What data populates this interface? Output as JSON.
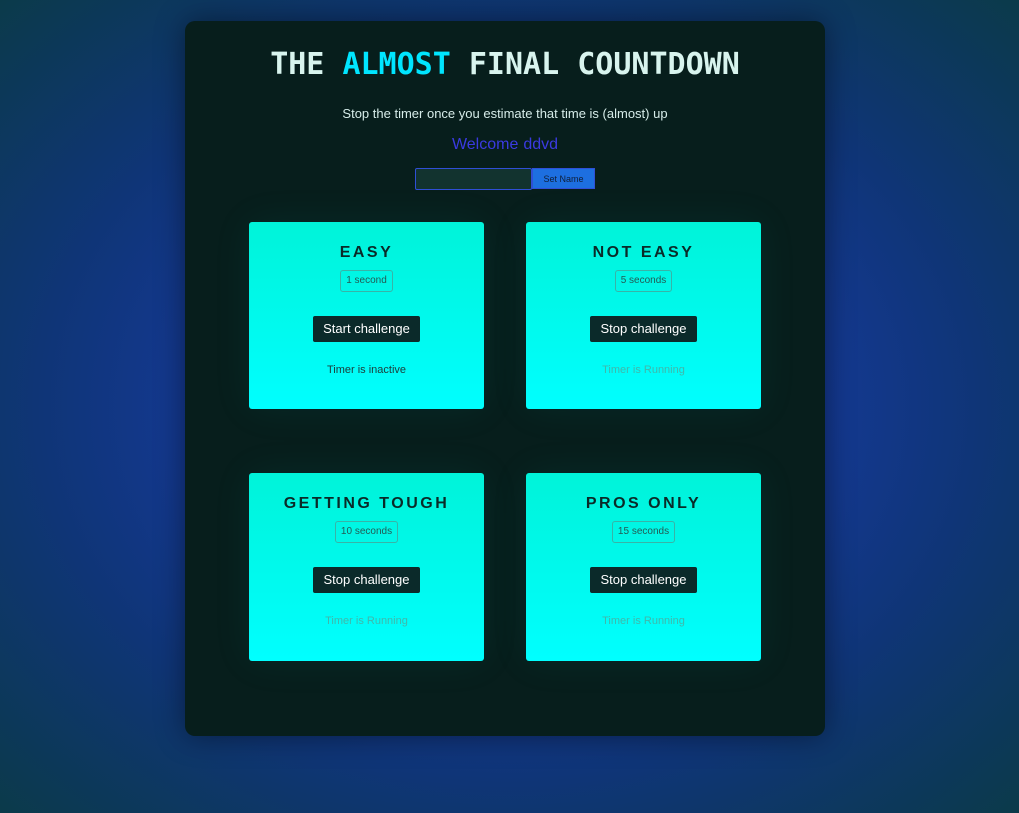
{
  "header": {
    "title_part1": "THE ",
    "title_highlight": "ALMOST",
    "title_part2": " FINAL COUNTDOWN",
    "subtitle": "Stop the timer once you estimate that time is (almost) up"
  },
  "welcome": {
    "label": "Welcome",
    "username": "ddvd"
  },
  "name_form": {
    "input_value": "",
    "input_placeholder": "",
    "button_label": "Set Name"
  },
  "challenges": [
    {
      "title": "EASY",
      "duration": "1 second",
      "button_label": "Start challenge",
      "status": "Timer is inactive"
    },
    {
      "title": "NOT EASY",
      "duration": "5 seconds",
      "button_label": "Stop challenge",
      "status": "Timer is Running"
    },
    {
      "title": "GETTING TOUGH",
      "duration": "10 seconds",
      "button_label": "Stop challenge",
      "status": "Timer is Running"
    },
    {
      "title": "PROS ONLY",
      "duration": "15 seconds",
      "button_label": "Stop challenge",
      "status": "Timer is Running"
    }
  ],
  "colors": {
    "accent": "#00e5ff",
    "card_top": "#00f3d9",
    "card_bottom": "#00ffff",
    "welcome": "#3a3ae0",
    "panel": "#071e1c"
  }
}
